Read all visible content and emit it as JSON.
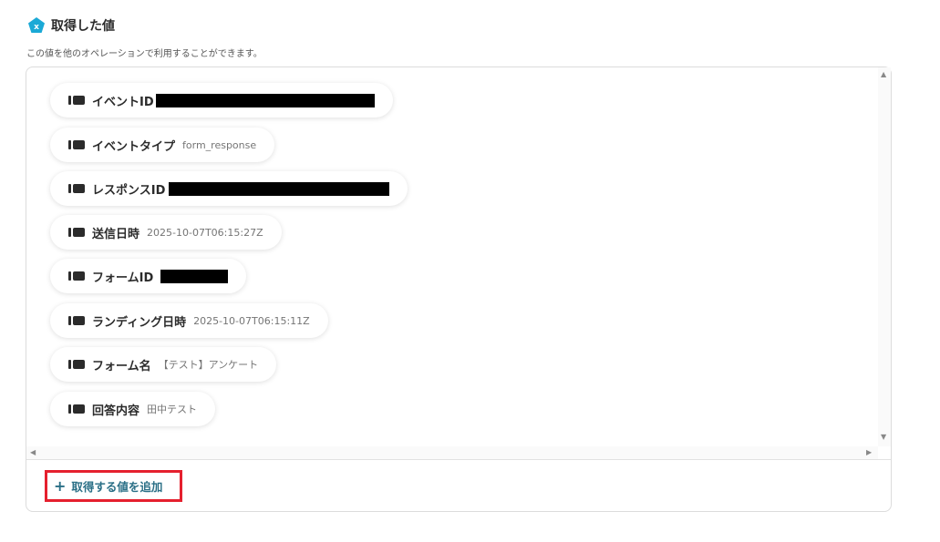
{
  "section": {
    "title": "取得した値",
    "description": "この値を他のオペレーションで利用することができます。",
    "logo_icon": "pentagon-x-logo-icon",
    "accent_color": "#1ba9d6"
  },
  "items": [
    {
      "label": "イベントID",
      "value": "",
      "redacted": true
    },
    {
      "label": "イベントタイプ",
      "value": "form_response",
      "redacted": false
    },
    {
      "label": "レスポンスID",
      "value": "",
      "redacted": true
    },
    {
      "label": "送信日時",
      "value": "2025-10-07T06:15:27Z",
      "redacted": false
    },
    {
      "label": "フォームID",
      "value": "",
      "redacted": true
    },
    {
      "label": "ランディング日時",
      "value": "2025-10-07T06:15:11Z",
      "redacted": false
    },
    {
      "label": "フォーム名",
      "value": "【テスト】アンケート",
      "redacted": false
    },
    {
      "label": "回答内容",
      "value": "田中テスト",
      "redacted": false
    }
  ],
  "add_button": {
    "label": "取得する値を追加",
    "icon": "plus-icon",
    "color": "#2a6f86",
    "highlight_color": "#e5202e"
  },
  "scrollbars": {
    "up_icon": "▲",
    "down_icon": "▼",
    "left_icon": "◀",
    "right_icon": "▶"
  }
}
